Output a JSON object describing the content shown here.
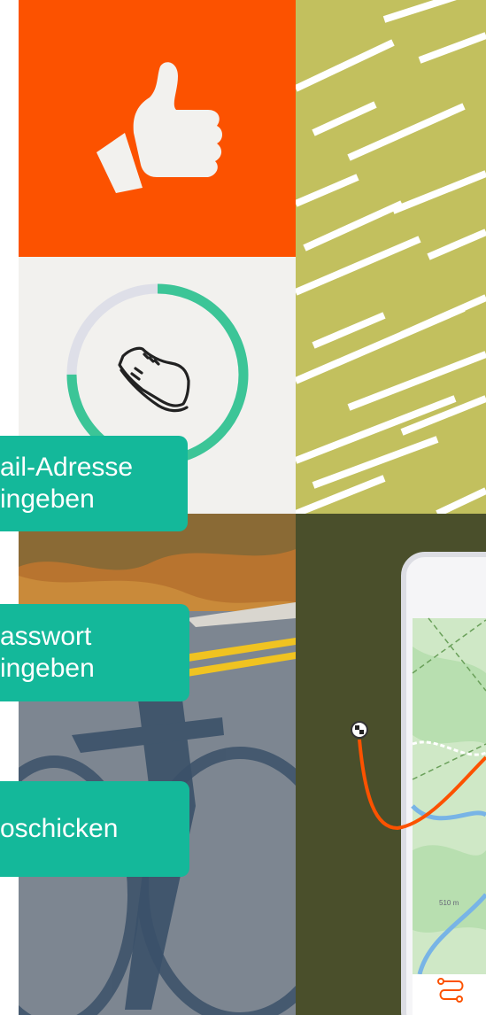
{
  "colors": {
    "strava_orange": "#fc5200",
    "olive": "#c2c05e",
    "dark_olive": "#4a4f2b",
    "teal_button": "#14b89a",
    "progress_green": "#3cc597",
    "progress_track": "#dedfe8"
  },
  "icons": {
    "thumbs_up": "thumbs-up-icon",
    "shoe": "running-shoe-icon",
    "finish_flag": "finish-flag-icon",
    "route": "route-icon"
  },
  "progress_ring": {
    "fraction": 0.75
  },
  "steps": [
    {
      "line1": "ail-Adresse",
      "line2": "ingeben"
    },
    {
      "line1": "asswort",
      "line2": "ingeben"
    },
    {
      "line1": "oschicken"
    }
  ],
  "map": {
    "scale_label": "510 m"
  }
}
